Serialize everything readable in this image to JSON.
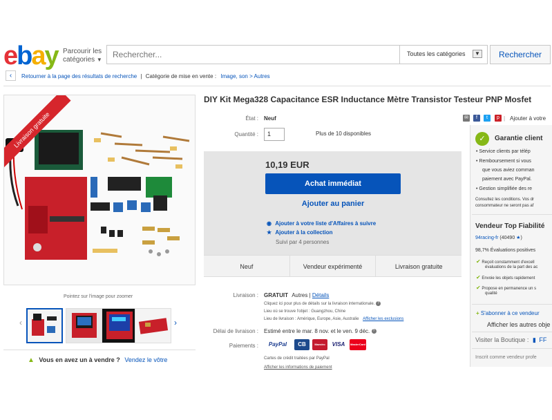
{
  "header": {
    "logo_letters": [
      "e",
      "b",
      "a",
      "y"
    ],
    "browse_line1": "Parcourir les",
    "browse_line2": "catégories",
    "search_placeholder": "Rechercher...",
    "category_select": "Toutes les catégories",
    "search_button": "Rechercher"
  },
  "breadcrumb": {
    "back": "Retourner à la page des résultats de recherche",
    "separator": "|",
    "category_label": "Catégorie de mise en vente :",
    "path": "Image, son > Autres"
  },
  "gallery": {
    "banner": "Livraison gratuite",
    "zoom_hint": "Pointez sur l'image pour zoomer",
    "sell_prompt": "Vous en avez un à vendre ?",
    "sell_link": "Vendez le vôtre"
  },
  "item": {
    "title": "DIY Kit Mega328 Capacitance ESR Inductance Mètre Transistor Testeur PNP Mosfet",
    "condition_label": "État :",
    "condition_value": "Neuf",
    "quantity_label": "Quantité :",
    "quantity_value": "1",
    "availability": "Plus de 10 disponibles",
    "price": "10,19 EUR",
    "buy_now": "Achat immédiat",
    "add_to_cart": "Ajouter au panier",
    "watch_link": "Ajouter à votre liste d'Affaires à suivre",
    "collection_link": "Ajouter à la collection",
    "followers": "Suivi par 4 personnes",
    "features": [
      "Neuf",
      "Vendeur expérimenté",
      "Livraison gratuite"
    ]
  },
  "shipping": {
    "label": "Livraison :",
    "free": "GRATUIT",
    "carrier": "Autres",
    "sep": "|",
    "details_link": "Détails",
    "intl_note": "Cliquez ici pour plus de détails sur la livraison internationale.",
    "location_line": "Lieu où se trouve l'objet : Guangzhou, Chine",
    "ship_to_label": "Lieu de livraison : Amérique, Europe, Asie, Australie",
    "exclusions_link": "Afficher les exclusions",
    "delay_label": "Délai de livraison :",
    "delay_value": "Estimé entre le mar. 8 nov. et le ven. 9 déc.",
    "payments_label": "Paiements :",
    "card_note": "Cartes de crédit traitées par PayPal",
    "payment_info_link": "Afficher les informations de paiement",
    "payment_logos": [
      "PayPal",
      "CB",
      "Maestro",
      "VISA",
      "MasterCard"
    ]
  },
  "right": {
    "share_link": "Ajouter à votre",
    "guarantee_title": "Garantie client",
    "guarantee_items": [
      "Service clients par télép",
      "Remboursement si vous",
      "que vous aviez comman",
      "paiement avec PayPal.",
      "Gestion simplifiée des re"
    ],
    "conditions_line1": "Consultez les conditions. Vos dr",
    "conditions_line2": "consommateur ne seront pas af",
    "top_seller": "Vendeur Top Fiabilité",
    "seller_name": "94racing-fr",
    "seller_score": "(40490",
    "seller_score_close": ")",
    "positive": "98,7% Évaluations positives",
    "seller_points": [
      "Reçoit constamment d'excell",
      "évaluations de la part des ac",
      "Envoie les objets rapidement",
      "Propose en permanence un s",
      "qualité"
    ],
    "subscribe": "S'abonner à ce vendeur",
    "other_items": "Afficher les autres obje",
    "store_label": "Visiter la Boutique :",
    "store_name": "FF",
    "registered": "Inscrit comme vendeur profe"
  },
  "colors": {
    "ebay_red": "#e53238",
    "ebay_blue": "#0064d2",
    "ebay_yellow": "#f5af02",
    "ebay_green": "#86b817",
    "link_blue": "#0654ba",
    "buy_button": "#0654ba",
    "banner_red": "#d6262c"
  }
}
